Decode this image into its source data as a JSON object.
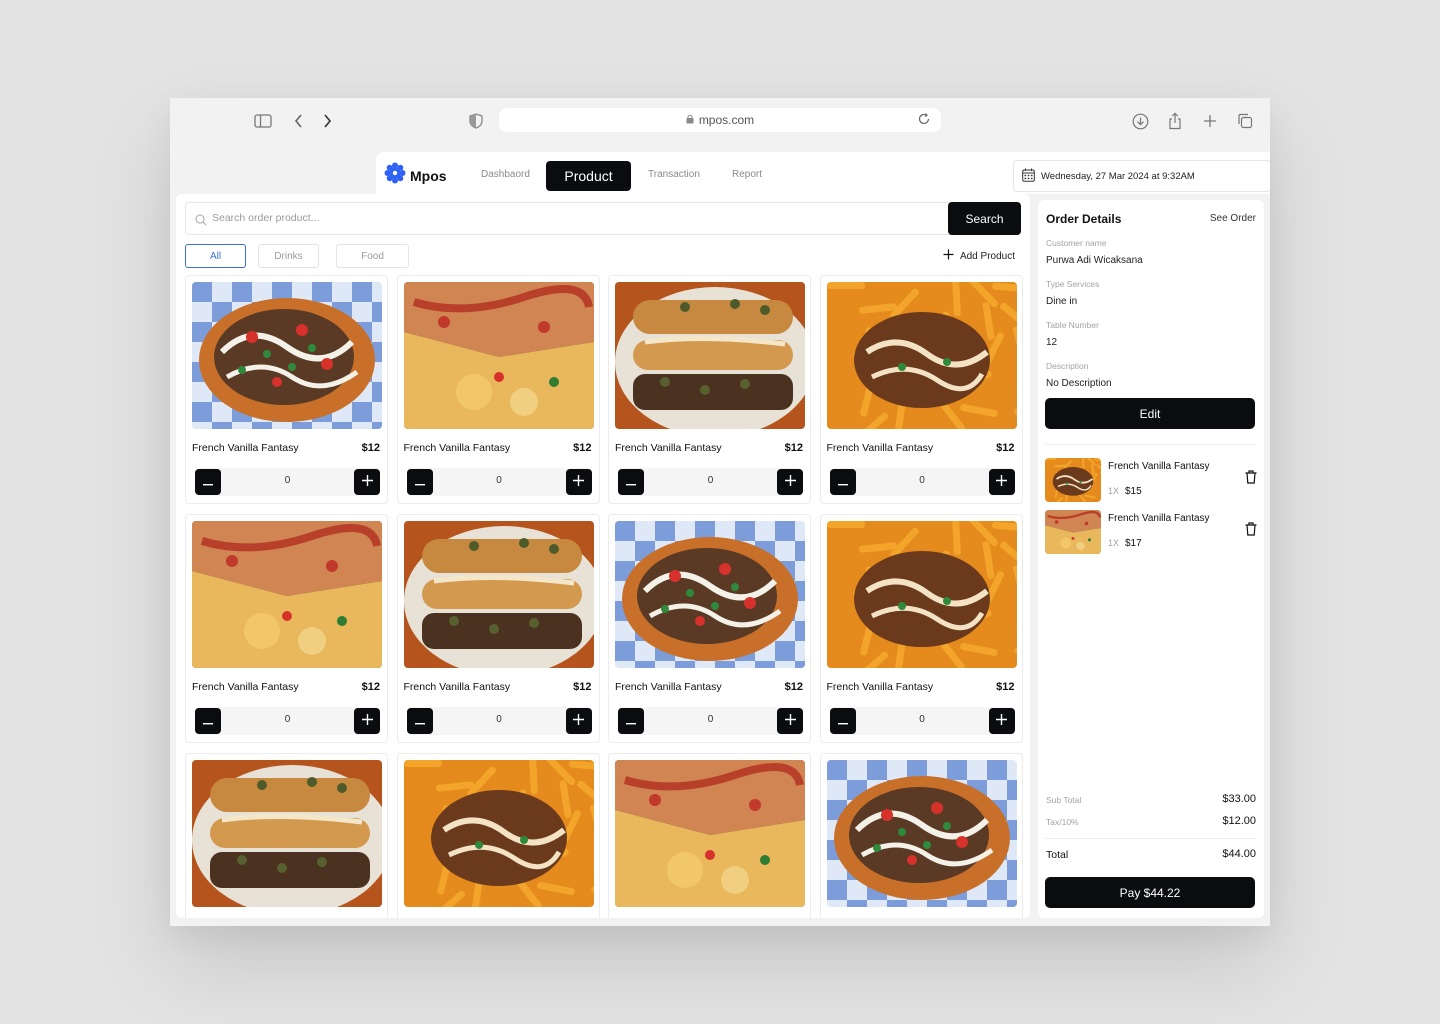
{
  "browser": {
    "url": "mpos.com",
    "icons": [
      "sidebar-icon",
      "back-icon",
      "forward-icon",
      "shield-icon",
      "lock-icon",
      "reload-icon",
      "download-icon",
      "share-icon",
      "new-tab-icon",
      "tabs-icon"
    ]
  },
  "app": {
    "brand": "Mpos",
    "nav": {
      "dashboard": "Dashbaord",
      "product": "Product",
      "transaction": "Transaction",
      "report": "Report"
    },
    "datetime": "Wednesday, 27 Mar 2024 at 9:32AM"
  },
  "search": {
    "placeholder": "Search order product...",
    "button": "Search"
  },
  "filters": {
    "all": "All",
    "drinks": "Drinks",
    "food": "Food",
    "selected": "All"
  },
  "add_product": "Add Product",
  "products": [
    {
      "name": "French Vanilla Fantasy",
      "price": "$12",
      "qty": "0",
      "image": "nachos"
    },
    {
      "name": "French Vanilla Fantasy",
      "price": "$12",
      "qty": "0",
      "image": "quesadilla"
    },
    {
      "name": "French Vanilla Fantasy",
      "price": "$12",
      "qty": "0",
      "image": "sandwich"
    },
    {
      "name": "French Vanilla Fantasy",
      "price": "$12",
      "qty": "0",
      "image": "fries"
    },
    {
      "name": "French Vanilla Fantasy",
      "price": "$12",
      "qty": "0",
      "image": "quesadilla"
    },
    {
      "name": "French Vanilla Fantasy",
      "price": "$12",
      "qty": "0",
      "image": "sandwich"
    },
    {
      "name": "French Vanilla Fantasy",
      "price": "$12",
      "qty": "0",
      "image": "nachos"
    },
    {
      "name": "French Vanilla Fantasy",
      "price": "$12",
      "qty": "0",
      "image": "fries"
    },
    {
      "image": "sandwich"
    },
    {
      "image": "fries"
    },
    {
      "image": "quesadilla"
    },
    {
      "image": "nachos"
    }
  ],
  "order": {
    "title": "Order Details",
    "see_order": "See Order",
    "customer_label": "Customer name",
    "customer": "Purwa Adi Wicaksana",
    "service_label": "Type Services",
    "service": "Dine in",
    "table_label": "Table Number",
    "table": "12",
    "description_label": "Description",
    "description": "No Description",
    "edit": "Edit",
    "items": [
      {
        "name": "French Vanilla Fantasy",
        "qty": "1X",
        "price": "$15",
        "image": "fries"
      },
      {
        "name": "French Vanilla Fantasy",
        "qty": "1X",
        "price": "$17",
        "image": "quesadilla"
      }
    ],
    "subtotal_label": "Sub Total",
    "subtotal": "$33.00",
    "tax_label": "Tax/10%",
    "tax": "$12.00",
    "total_label": "Total",
    "total": "$44.00",
    "pay": "Pay $44.22"
  },
  "colors": {
    "accent": "#0b0c10",
    "brand_logo": "#2f62f5",
    "filter_active": "#3b6fd8"
  }
}
